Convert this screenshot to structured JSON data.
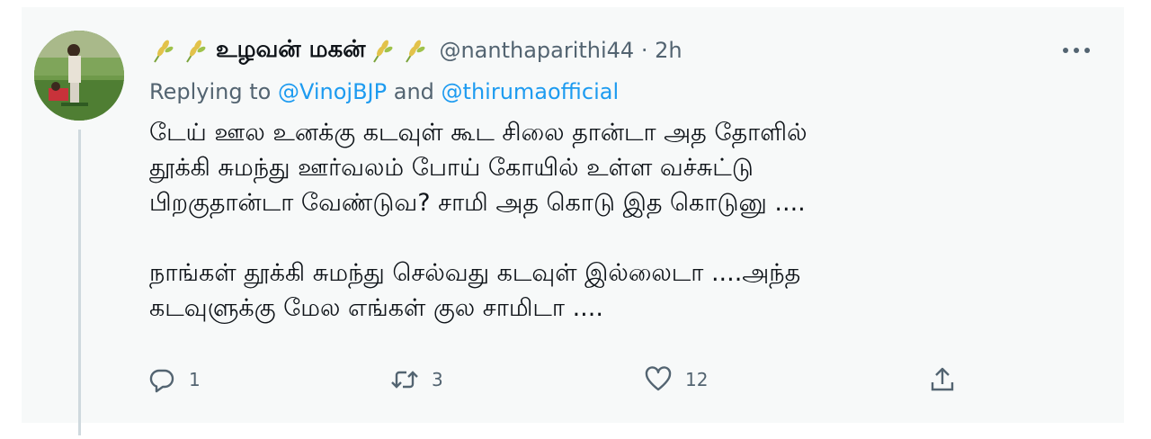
{
  "tweet": {
    "display_name": "உழவன் மகன்",
    "handle": "@nanthaparithi44",
    "separator": "·",
    "time": "2h",
    "replying_prefix": "Replying to",
    "reply_mention_1": "@VinojBJP",
    "replying_and": "and",
    "reply_mention_2": "@thirumaofficial",
    "body_lines": [
      "டேய் ஊல உனக்கு கடவுள் கூட சிலை தான்டா அத தோளில்",
      "தூக்கி சுமந்து ஊர்வலம் போய் கோயில் உள்ள வச்சுட்டு",
      "பிறகுதான்டா வேண்டுவ? சாமி அத கொடு இத கொடுனு ....",
      "நாங்கள் தூக்கி சுமந்து செல்வது கடவுள் இல்லைடா ....அந்த",
      "கடவுளுக்கு மேல எங்கள் குல சாமிடா ...."
    ],
    "actions": {
      "reply_count": "1",
      "retweet_count": "3",
      "like_count": "12"
    }
  },
  "icons": {
    "name_decoration": "wheat-emoji-icon",
    "more": "more-dots-icon",
    "reply": "reply-bubble-icon",
    "retweet": "retweet-icon",
    "like": "heart-icon",
    "share": "share-icon"
  },
  "colors": {
    "background": "#f7f9f9",
    "text": "#0f1419",
    "secondary": "#536471",
    "link": "#1d9bf0"
  }
}
